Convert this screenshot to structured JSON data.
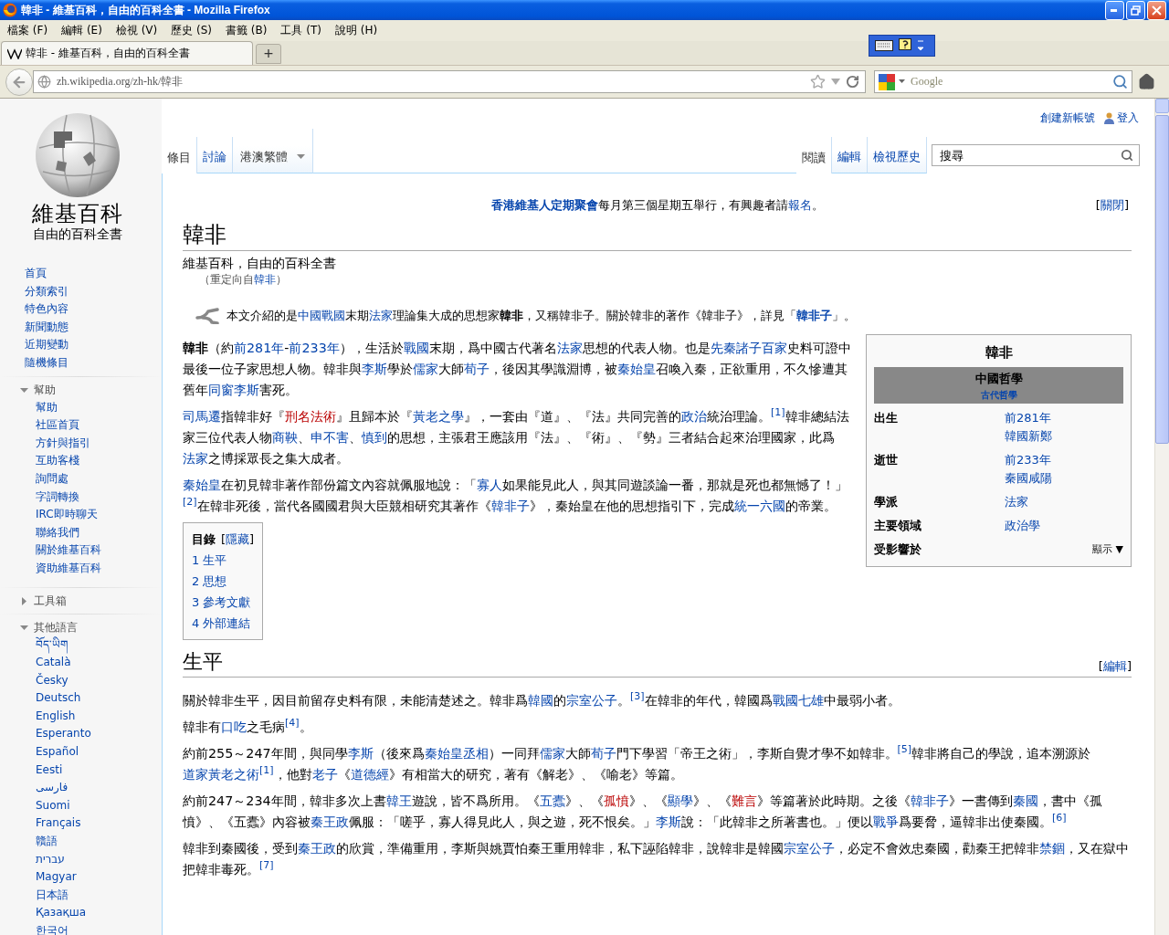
{
  "window": {
    "title": "韓非 - 維基百科，自由的百科全書 - Mozilla Firefox"
  },
  "menu": [
    "檔案 (F)",
    "編輯 (E)",
    "檢視 (V)",
    "歷史 (S)",
    "書籤 (B)",
    "工具 (T)",
    "說明 (H)"
  ],
  "browser_tabs": [
    {
      "title": "韓非 - 維基百科，自由的百科全書",
      "selected": true
    }
  ],
  "new_tab": "+",
  "address_bar": {
    "url": "zh.wikipedia.org/zh-hk/韓非"
  },
  "search_bar": {
    "placeholder": "Google"
  },
  "personal": [
    {
      "label": "創建新帳號",
      "kind": "link"
    },
    {
      "label": "登入",
      "kind": "login"
    }
  ],
  "logo": {
    "name": "維基百科",
    "tagline": "自由的百科全書"
  },
  "navigation": [
    "首頁",
    "分類索引",
    "特色內容",
    "新聞動態",
    "近期變動",
    "隨機條目"
  ],
  "portals": [
    {
      "title": "幫助",
      "expanded": true,
      "items": [
        "幫助",
        "社區首頁",
        "方針與指引",
        "互助客棧",
        "詢問處",
        "字詞轉換",
        "IRC即時聊天",
        "聯絡我們",
        "關於維基百科",
        "資助維基百科"
      ]
    },
    {
      "title": "工具箱",
      "expanded": false
    },
    {
      "title": "其他語言",
      "expanded": true,
      "items": [
        "བོད་ཡིག",
        "Català",
        "Česky",
        "Deutsch",
        "English",
        "Esperanto",
        "Español",
        "Eesti",
        "فارسی",
        "Suomi",
        "Français",
        "贛語",
        "עברית",
        "Magyar",
        "日本語",
        "Қазақша",
        "한국어"
      ]
    }
  ],
  "left_tabs": [
    {
      "label": "條目",
      "selected": true
    },
    {
      "label": "討論",
      "selected": false
    }
  ],
  "variant": {
    "label": "港澳繁體"
  },
  "right_tabs": [
    {
      "label": "閱讀",
      "selected": true
    },
    {
      "label": "編輯",
      "selected": false
    },
    {
      "label": "檢視歷史",
      "selected": false
    }
  ],
  "wiki_search": {
    "placeholder": "搜尋"
  },
  "site_notice": [
    {
      "text": "香港維基人定期聚會",
      "kind": "boldlink"
    },
    {
      "text": "每月第三個星期五舉行，有興趣者請",
      "kind": "text"
    },
    {
      "text": "報名",
      "kind": "link"
    },
    {
      "text": "。",
      "kind": "text"
    }
  ],
  "dismiss": [
    {
      "text": "[",
      "kind": "text"
    },
    {
      "text": "關閉",
      "kind": "link"
    },
    {
      "text": "]",
      "kind": "text"
    }
  ],
  "heading": "韓非",
  "tagline": "維基百科，自由的百科全書",
  "redirect": [
    {
      "text": "（重定向自",
      "kind": "text"
    },
    {
      "text": "韓非",
      "kind": "link"
    },
    {
      "text": "）",
      "kind": "text"
    }
  ],
  "hatnote": [
    {
      "text": "本文介紹的是",
      "kind": "text"
    },
    {
      "text": "中國戰國",
      "kind": "link"
    },
    {
      "text": "末期",
      "kind": "text"
    },
    {
      "text": "法家",
      "kind": "link"
    },
    {
      "text": "理論集大成的思想家",
      "kind": "text"
    },
    {
      "text": "韓非",
      "kind": "bold"
    },
    {
      "text": "，又稱韓非子。關於韓非的著作《韓非子》，詳見「",
      "kind": "text"
    },
    {
      "text": "韓非子",
      "kind": "boldlink"
    },
    {
      "text": "」。",
      "kind": "text"
    }
  ],
  "infobox": {
    "title": "韓非",
    "header": "中國哲學",
    "subheader": "古代哲學",
    "rows": [
      {
        "kind": "field",
        "label": "出生",
        "values": [
          "前281年",
          "韓國新鄭"
        ]
      },
      {
        "kind": "field",
        "label": "逝世",
        "values": [
          "前233年",
          "秦國咸陽"
        ]
      },
      {
        "kind": "field",
        "label": "學派",
        "values": [
          "法家"
        ]
      },
      {
        "kind": "field",
        "label": "主要領域",
        "values": [
          "政治學"
        ]
      },
      {
        "kind": "collapsed",
        "label": "受影響於",
        "toggle": "顯示",
        "caret": "▼"
      }
    ]
  },
  "intro": [
    [
      {
        "text": "韓非",
        "kind": "bold"
      },
      {
        "text": "（約",
        "kind": "text"
      },
      {
        "text": "前281年",
        "kind": "link"
      },
      {
        "text": "-",
        "kind": "text"
      },
      {
        "text": "前233年",
        "kind": "link"
      },
      {
        "text": "），生活於",
        "kind": "text"
      },
      {
        "text": "戰國",
        "kind": "link"
      },
      {
        "text": "末期，爲中國古代著名",
        "kind": "text"
      },
      {
        "text": "法家",
        "kind": "link"
      },
      {
        "text": "思想的代表人物。也是",
        "kind": "text"
      },
      {
        "text": "先秦諸子百家",
        "kind": "link"
      },
      {
        "text": "史料可證中最後一位子家思想人物。韓非與",
        "kind": "text"
      },
      {
        "text": "李斯",
        "kind": "link"
      },
      {
        "text": "學於",
        "kind": "text"
      },
      {
        "text": "儒家",
        "kind": "link"
      },
      {
        "text": "大師",
        "kind": "text"
      },
      {
        "text": "荀子",
        "kind": "link"
      },
      {
        "text": "，後因其學識淵博，被",
        "kind": "text"
      },
      {
        "text": "秦始皇",
        "kind": "link"
      },
      {
        "text": "召喚入秦，正欲重用，不久慘遭其舊年",
        "kind": "text"
      },
      {
        "text": "同窗李斯",
        "kind": "link"
      },
      {
        "text": "害死。",
        "kind": "text"
      }
    ],
    [
      {
        "text": "司馬遷",
        "kind": "link"
      },
      {
        "text": "指韓非好『",
        "kind": "text"
      },
      {
        "text": "刑名法術",
        "kind": "new"
      },
      {
        "text": "』且歸本於『",
        "kind": "text"
      },
      {
        "text": "黃老之學",
        "kind": "link"
      },
      {
        "text": "』，一套由『道』、『法』共同完善的",
        "kind": "text"
      },
      {
        "text": "政治",
        "kind": "link"
      },
      {
        "text": "統治理論。",
        "kind": "text"
      },
      {
        "text": "[1]",
        "kind": "ref"
      },
      {
        "text": "韓非總結法家三位代表人物",
        "kind": "text"
      },
      {
        "text": "商鞅",
        "kind": "link"
      },
      {
        "text": "、",
        "kind": "text"
      },
      {
        "text": "申不害",
        "kind": "link"
      },
      {
        "text": "、",
        "kind": "text"
      },
      {
        "text": "慎到",
        "kind": "link"
      },
      {
        "text": "的思想，主張君王應該用『法』、『術』、『勢』三者結合起來治理國家，此爲",
        "kind": "text"
      },
      {
        "text": "法家",
        "kind": "link"
      },
      {
        "text": "之博採眾長之集大成者。",
        "kind": "text"
      }
    ],
    [
      {
        "text": "秦始皇",
        "kind": "link"
      },
      {
        "text": "在初見韓非著作部份篇文內容就佩服地說：「",
        "kind": "text"
      },
      {
        "text": "寡人",
        "kind": "link"
      },
      {
        "text": "如果能見此人，與其同遊談論一番，那就是死也都無憾了！」",
        "kind": "text"
      },
      {
        "text": "[2]",
        "kind": "ref"
      },
      {
        "text": "在韓非死後，當代各國國君與大臣競相研究其著作《",
        "kind": "text"
      },
      {
        "text": "韓非子",
        "kind": "link"
      },
      {
        "text": "》，秦始皇在他的思想指引下，完成",
        "kind": "text"
      },
      {
        "text": "統一六國",
        "kind": "link"
      },
      {
        "text": "的帝業。",
        "kind": "text"
      }
    ]
  ],
  "toc": {
    "title": "目錄",
    "toggle": [
      {
        "text": "[",
        "kind": "text"
      },
      {
        "text": "隱藏",
        "kind": "link"
      },
      {
        "text": "]",
        "kind": "text"
      }
    ],
    "items": [
      {
        "number": "1",
        "label": "生平"
      },
      {
        "number": "2",
        "label": "思想"
      },
      {
        "number": "3",
        "label": "參考文獻"
      },
      {
        "number": "4",
        "label": "外部連結"
      }
    ]
  },
  "section": {
    "title": "生平",
    "edit": [
      {
        "text": "[",
        "kind": "text"
      },
      {
        "text": "編輯",
        "kind": "link"
      },
      {
        "text": "]",
        "kind": "text"
      }
    ],
    "paragraphs": [
      [
        {
          "text": "關於韓非生平，因目前留存史料有限，未能清楚述之。韓非爲",
          "kind": "text"
        },
        {
          "text": "韓國",
          "kind": "link"
        },
        {
          "text": "的",
          "kind": "text"
        },
        {
          "text": "宗室公子",
          "kind": "link"
        },
        {
          "text": "。",
          "kind": "text"
        },
        {
          "text": "[3]",
          "kind": "ref"
        },
        {
          "text": "在韓非的年代，韓國爲",
          "kind": "text"
        },
        {
          "text": "戰國七雄",
          "kind": "link"
        },
        {
          "text": "中最弱小者。",
          "kind": "text"
        }
      ],
      [
        {
          "text": "韓非有",
          "kind": "text"
        },
        {
          "text": "口吃",
          "kind": "link"
        },
        {
          "text": "之毛病",
          "kind": "text"
        },
        {
          "text": "[4]",
          "kind": "ref"
        },
        {
          "text": "。",
          "kind": "text"
        }
      ],
      [
        {
          "text": "約前255～247年間，與同學",
          "kind": "text"
        },
        {
          "text": "李斯",
          "kind": "link"
        },
        {
          "text": "（後來爲",
          "kind": "text"
        },
        {
          "text": "秦始皇丞相",
          "kind": "link"
        },
        {
          "text": "）一同拜",
          "kind": "text"
        },
        {
          "text": "儒家",
          "kind": "link"
        },
        {
          "text": "大師",
          "kind": "text"
        },
        {
          "text": "荀子",
          "kind": "link"
        },
        {
          "text": "門下學習「帝王之術」，李斯自覺才學不如韓非。",
          "kind": "text"
        },
        {
          "text": "[5]",
          "kind": "ref"
        },
        {
          "text": "韓非將自己的學說，追本溯源於",
          "kind": "text"
        },
        {
          "text": "道家黃老之術",
          "kind": "link"
        },
        {
          "text": "[1]",
          "kind": "ref"
        },
        {
          "text": "，他對",
          "kind": "text"
        },
        {
          "text": "老子",
          "kind": "link"
        },
        {
          "text": "《",
          "kind": "text"
        },
        {
          "text": "道德經",
          "kind": "link"
        },
        {
          "text": "》有相當大的研究，著有《解老》、《喻老》等篇。",
          "kind": "text"
        }
      ],
      [
        {
          "text": "約前247～234年間，韓非多次上書",
          "kind": "text"
        },
        {
          "text": "韓王",
          "kind": "link"
        },
        {
          "text": "遊說，皆不爲所用。《",
          "kind": "text"
        },
        {
          "text": "五蠹",
          "kind": "link"
        },
        {
          "text": "》、《",
          "kind": "text"
        },
        {
          "text": "孤憤",
          "kind": "new"
        },
        {
          "text": "》、《",
          "kind": "text"
        },
        {
          "text": "顯學",
          "kind": "link"
        },
        {
          "text": "》、《",
          "kind": "text"
        },
        {
          "text": "難言",
          "kind": "new"
        },
        {
          "text": "》等篇著於此時期。之後《",
          "kind": "text"
        },
        {
          "text": "韓非子",
          "kind": "link"
        },
        {
          "text": "》一書傳到",
          "kind": "text"
        },
        {
          "text": "秦國",
          "kind": "link"
        },
        {
          "text": "，書中《孤憤》、《五蠹》內容被",
          "kind": "text"
        },
        {
          "text": "秦王政",
          "kind": "link"
        },
        {
          "text": "佩服：「嗟乎，寡人得見此人，與之遊，死不恨矣。」",
          "kind": "text"
        },
        {
          "text": "李斯",
          "kind": "link"
        },
        {
          "text": "說：「此韓非之所著書也。」便以",
          "kind": "text"
        },
        {
          "text": "戰爭",
          "kind": "link"
        },
        {
          "text": "爲要脅，逼韓非出使秦國。",
          "kind": "text"
        },
        {
          "text": "[6]",
          "kind": "ref"
        }
      ],
      [
        {
          "text": "韓非到秦國後，受到",
          "kind": "text"
        },
        {
          "text": "秦王政",
          "kind": "link"
        },
        {
          "text": "的欣賞，準備重用，李斯與姚賈怕秦王重用韓非，私下誣陷韓非，說韓非是韓國",
          "kind": "text"
        },
        {
          "text": "宗室公子",
          "kind": "link"
        },
        {
          "text": "，必定不會效忠秦國，勸秦王把韓非",
          "kind": "text"
        },
        {
          "text": "禁錮",
          "kind": "link"
        },
        {
          "text": "，又在獄中把韓非毒死。",
          "kind": "text"
        },
        {
          "text": "[7]",
          "kind": "ref"
        }
      ]
    ]
  }
}
